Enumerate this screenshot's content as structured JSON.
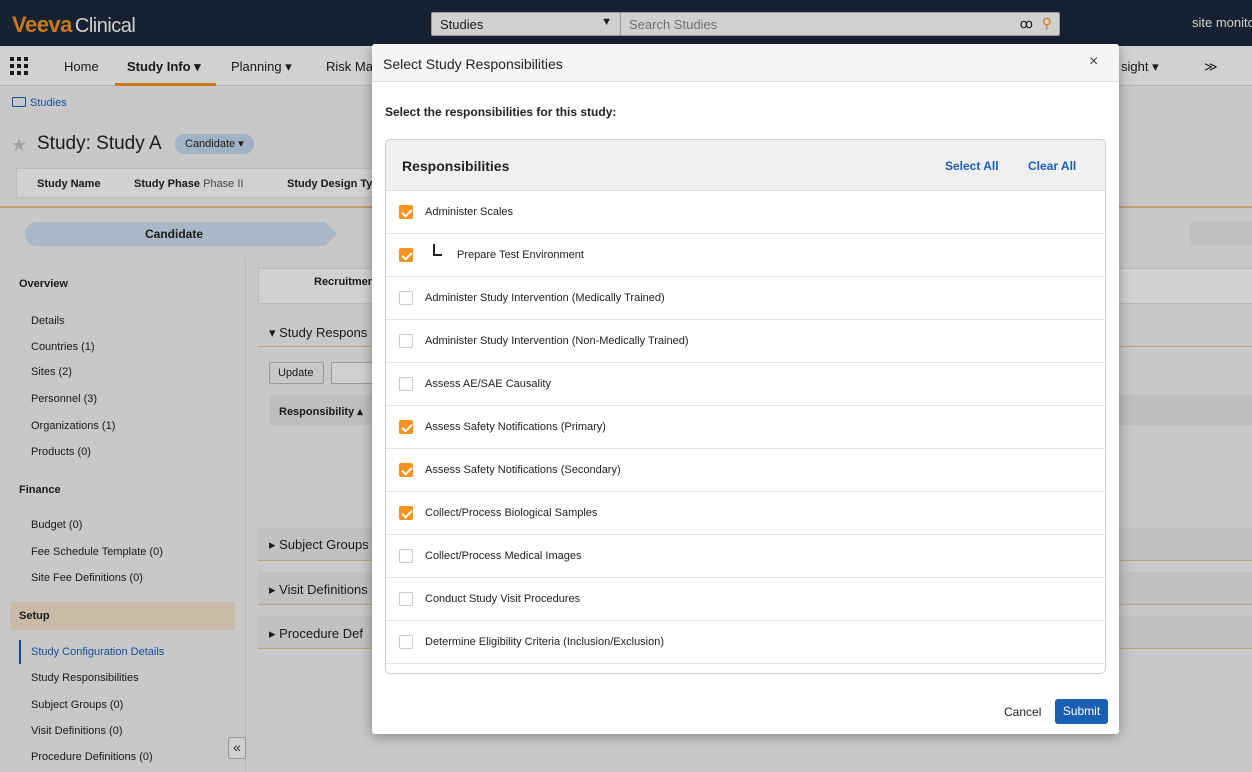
{
  "topbar": {
    "logo_brand": "Veeva",
    "logo_product": "Clinical",
    "study_selector": "Studies",
    "search_placeholder": "Search Studies",
    "user_name": "site monito"
  },
  "nav": {
    "items": [
      {
        "label": "Home"
      },
      {
        "label": "Study Info ▾"
      },
      {
        "label": "Planning ▾"
      },
      {
        "label": "Risk Ma"
      },
      {
        "label": "sight ▾"
      },
      {
        "label": "≫"
      }
    ]
  },
  "breadcrumb": "Studies",
  "header": {
    "title": "Study: Study A",
    "status": "Candidate ▾",
    "fields": [
      {
        "label": "Study Name",
        "value": ""
      },
      {
        "label": "Study Phase",
        "value": "Phase II"
      },
      {
        "label": "Study Design Ty",
        "value": ""
      }
    ]
  },
  "lifecycle": {
    "current": "Candidate"
  },
  "sidebar": {
    "sections": [
      {
        "heading": "Overview",
        "items": [
          "Details",
          "Countries (1)",
          "Sites (2)",
          "Personnel (3)",
          "Organizations (1)",
          "Products (0)"
        ]
      },
      {
        "heading": "Finance",
        "items": [
          "Budget (0)",
          "Fee Schedule Template (0)",
          "Site Fee Definitions (0)"
        ]
      },
      {
        "heading": "Setup",
        "items": [
          "Study Configuration Details",
          "Study Responsibilities",
          "Subject Groups (0)",
          "Visit Definitions (0)",
          "Procedure Definitions (0)"
        ]
      }
    ],
    "collapse_label": "«"
  },
  "main": {
    "tab_label": "Recruitmen",
    "section_title": "▾  Study Respons",
    "update_label": "Update",
    "column_header": "Responsibility ▴",
    "collapsed_sections": [
      "▸  Subject Groups",
      "▸  Visit Definitions",
      "▸  Procedure Def"
    ]
  },
  "modal": {
    "title": "Select Study Responsibilities",
    "close": "×",
    "instruction": "Select the responsibilities for this study:",
    "panel_title": "Responsibilities",
    "select_all": "Select All",
    "clear_all": "Clear All",
    "items": [
      {
        "label": "Administer Scales",
        "checked": true,
        "child": false
      },
      {
        "label": "Prepare Test Environment",
        "checked": true,
        "child": true
      },
      {
        "label": "Administer Study Intervention (Medically Trained)",
        "checked": false,
        "child": false
      },
      {
        "label": "Administer Study Intervention (Non-Medically Trained)",
        "checked": false,
        "child": false
      },
      {
        "label": "Assess AE/SAE Causality",
        "checked": false,
        "child": false
      },
      {
        "label": "Assess Safety Notifications (Primary)",
        "checked": true,
        "child": false
      },
      {
        "label": "Assess Safety Notifications (Secondary)",
        "checked": true,
        "child": false
      },
      {
        "label": "Collect/Process Biological Samples",
        "checked": true,
        "child": false
      },
      {
        "label": "Collect/Process Medical Images",
        "checked": false,
        "child": false
      },
      {
        "label": "Conduct Study Visit Procedures",
        "checked": false,
        "child": false
      },
      {
        "label": "Determine Eligibility Criteria (Inclusion/Exclusion)",
        "checked": false,
        "child": false
      }
    ],
    "cancel": "Cancel",
    "submit": "Submit"
  },
  "colors": {
    "topbar": "#1c2a3d",
    "accent_orange": "#f7931e",
    "link_blue": "#1a5fb4",
    "lifecycle_blue": "#cfe0f2"
  }
}
